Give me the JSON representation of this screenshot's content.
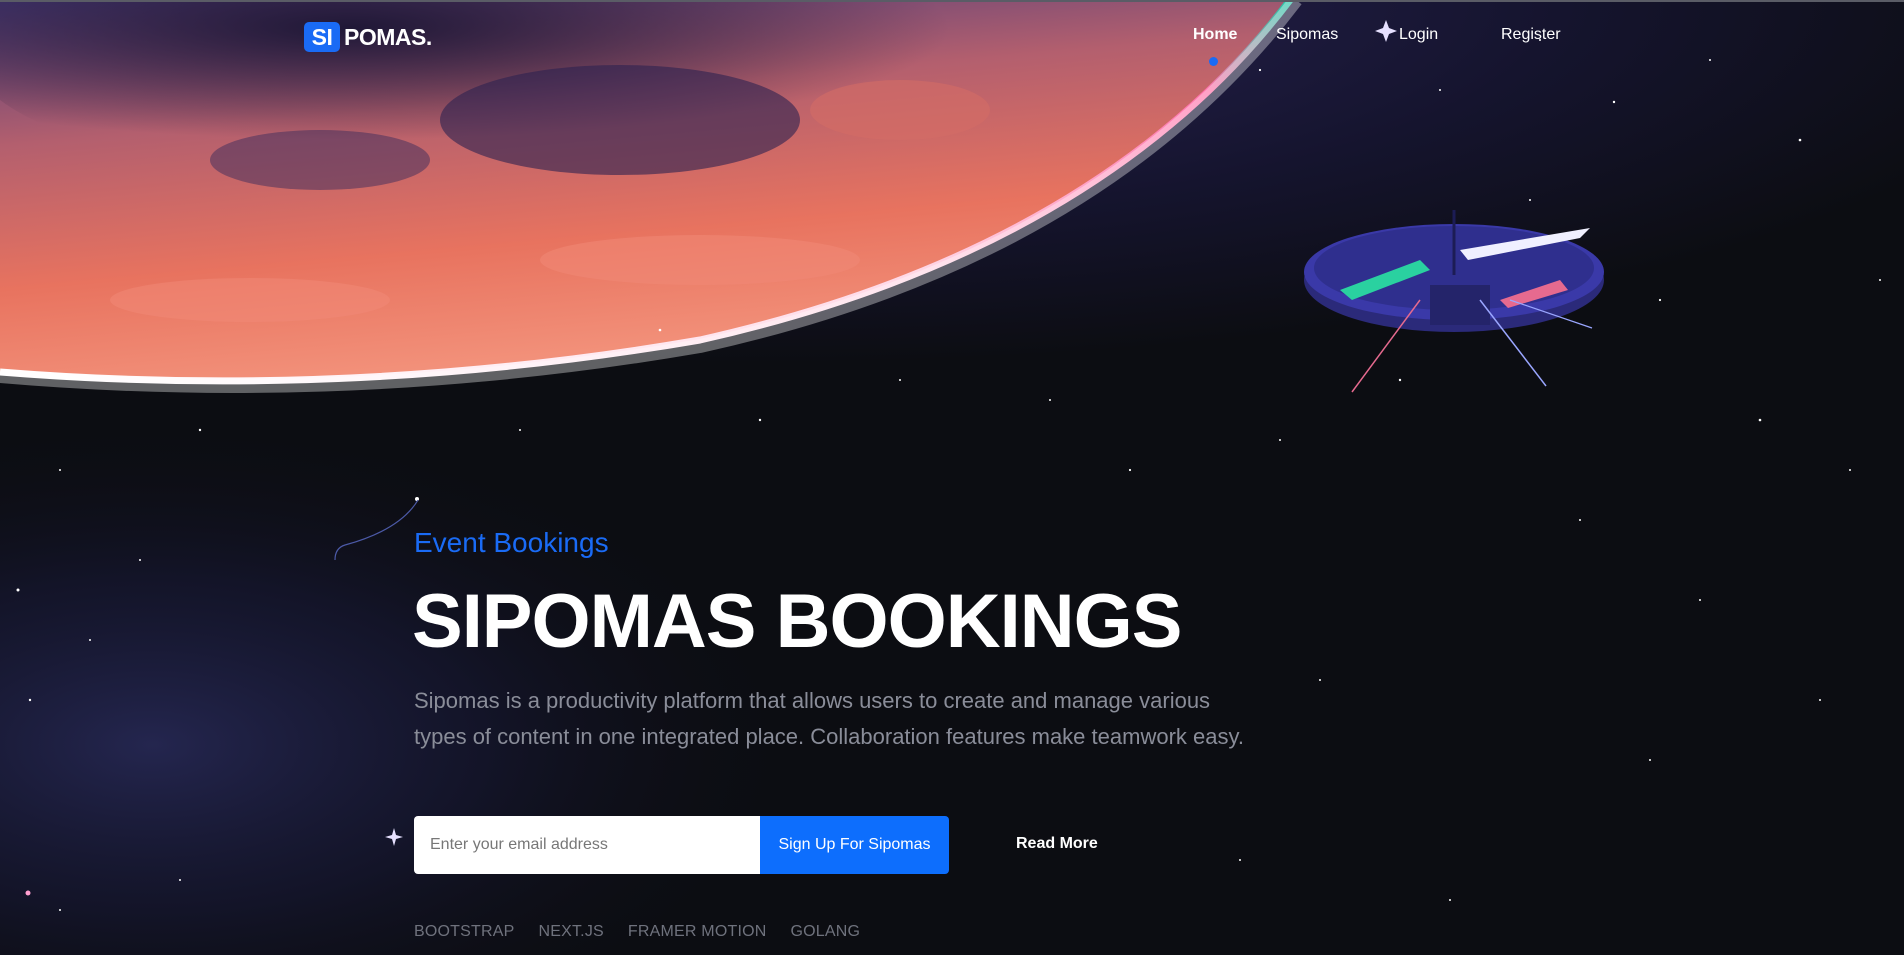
{
  "brand": {
    "badge": "SI",
    "name": "POMAS."
  },
  "nav": {
    "items": [
      {
        "label": "Home",
        "active": true
      },
      {
        "label": "Sipomas"
      },
      {
        "label": "Login"
      },
      {
        "label": "Register"
      }
    ]
  },
  "hero": {
    "eyebrow": "Event Bookings",
    "title": "SIPOMAS BOOKINGS",
    "description": "Sipomas is a productivity platform that allows users to create and manage various types of content in one integrated place. Collaboration features make teamwork easy.",
    "email_placeholder": "Enter your email address",
    "signup_label": "Sign Up For Sipomas",
    "read_more_label": "Read More",
    "tech": [
      "BOOTSTRAP",
      "NEXT.JS",
      "FRAMER MOTION",
      "GOLANG"
    ]
  },
  "colors": {
    "accent": "#1a6bf5",
    "button": "#0d6efd",
    "background": "#0c0d12",
    "planet": "#e8735f",
    "muted_text": "#8a8d99"
  }
}
